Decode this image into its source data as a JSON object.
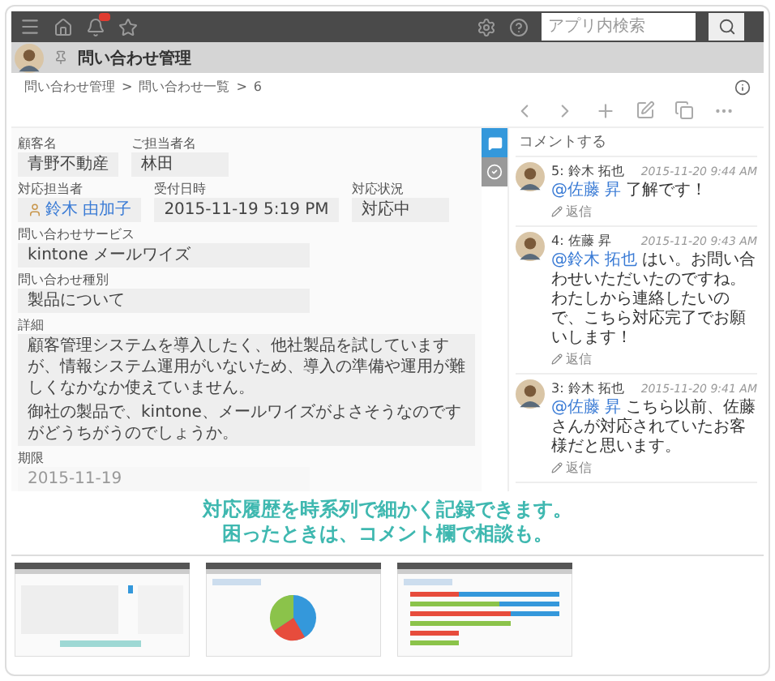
{
  "topbar": {
    "search": {
      "placeholder": "アプリ内検索"
    }
  },
  "app": {
    "title": "問い合わせ管理"
  },
  "breadcrumb": [
    {
      "label": "問い合わせ管理"
    },
    {
      "label": "問い合わせ一覧"
    },
    {
      "label": "6"
    }
  ],
  "breadcrumb_separator": ">",
  "form": {
    "rows": [
      [
        {
          "label": "顧客名",
          "value": "青野不動産",
          "kind": "text"
        },
        {
          "label": "ご担当者名",
          "value": "林田",
          "kind": "text"
        }
      ],
      [
        {
          "label": "対応担当者",
          "value": "鈴木 由加子",
          "kind": "user"
        },
        {
          "label": "受付日時",
          "value": "2015-11-19 5:19 PM",
          "kind": "text"
        },
        {
          "label": "対応状況",
          "value": "対応中",
          "kind": "text"
        }
      ],
      [
        {
          "label": "問い合わせサービス",
          "value": "kintone メールワイズ",
          "kind": "text"
        }
      ],
      [
        {
          "label": "問い合わせ種別",
          "value": "製品について",
          "kind": "text"
        }
      ],
      [
        {
          "label": "詳細",
          "paragraphs": [
            "顧客管理システムを導入したく、他社製品を試していますが、情報システム運用がいないため、導入の準備や運用が難しくなかなか使えていません。",
            "御社の製品で、kintone、メールワイズがよさそうなのですがどうちがうのでしょうか。"
          ],
          "kind": "multiline"
        }
      ],
      [
        {
          "label": "期限",
          "value": "2015-11-19",
          "kind": "faded"
        }
      ]
    ]
  },
  "side_tabs": [
    {
      "kind": "comments",
      "selected": true
    },
    {
      "kind": "history",
      "selected": false
    }
  ],
  "comments": {
    "placeholder": "コメントする",
    "items": [
      {
        "author": "5: 鈴木 拓也",
        "time": "2015-11-20 9:44 AM",
        "mention": "@佐藤 昇",
        "text": "了解です！",
        "reply": "返信"
      },
      {
        "author": "4: 佐藤 昇",
        "time": "2015-11-20 9:43 AM",
        "mention": "@鈴木 拓也",
        "text": "はい。お問い合わせいただいたのですね。わたしから連絡したいので、こちら対応完了でお願いします！",
        "reply": "返信"
      },
      {
        "author": "3: 鈴木 拓也",
        "time": "2015-11-20 9:41 AM",
        "mention": "@佐藤 昇",
        "text": "こちら以前、佐藤さんが対応されていたお客様だと思います。",
        "reply": "返信"
      }
    ]
  },
  "caption": [
    "対応履歴を時系列で細かく記録できます。",
    "困ったときは、コメント欄で相談も。"
  ],
  "thumbnails": [
    {
      "kind": "record"
    },
    {
      "kind": "pie"
    },
    {
      "kind": "bar"
    }
  ]
}
